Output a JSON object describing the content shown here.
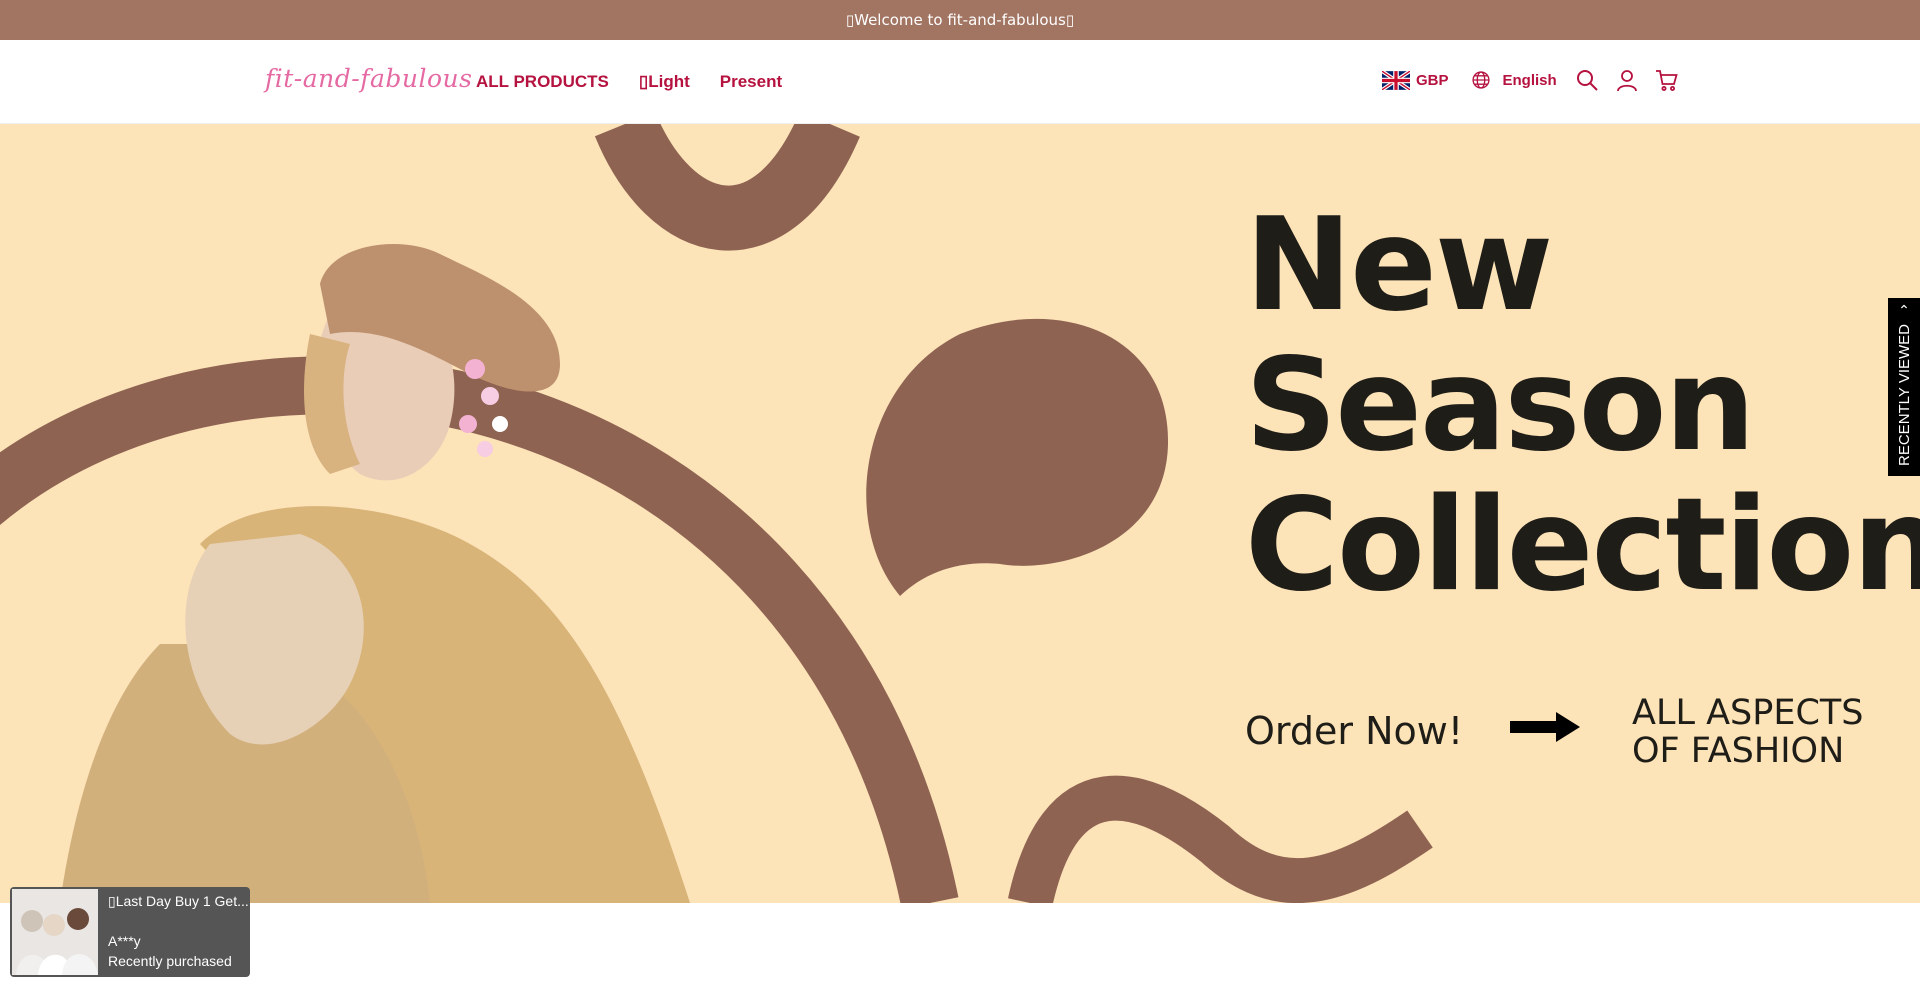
{
  "announcement": {
    "text": "▯Welcome to fit-and-fabulous▯"
  },
  "header": {
    "logo": "fit-and-fabulous",
    "nav": [
      "ALL PRODUCTS",
      "▯Light",
      "Present"
    ],
    "currency": "GBP",
    "language": "English",
    "icons": [
      "uk-flag-icon",
      "globe-icon",
      "search-icon",
      "account-icon",
      "cart-icon"
    ]
  },
  "hero": {
    "title": [
      "New",
      "Season",
      "Collection"
    ],
    "cta": "Order Now!",
    "tagline": [
      "ALL ASPECTS",
      "OF FASHION"
    ]
  },
  "sidebar": {
    "recently_viewed": "RECENTLY VIEWED"
  },
  "toast": {
    "title": "▯Last Day Buy 1 Get...",
    "buyer": "A***y",
    "status": "Recently purchased"
  },
  "colors": {
    "announcement_bg": "#a27462",
    "nav_text": "#b5123f",
    "logo": "#e56aa3",
    "hero_bg": "#fde3b8",
    "hero_shape": "#8f6352",
    "hero_text": "#1e1d17"
  }
}
